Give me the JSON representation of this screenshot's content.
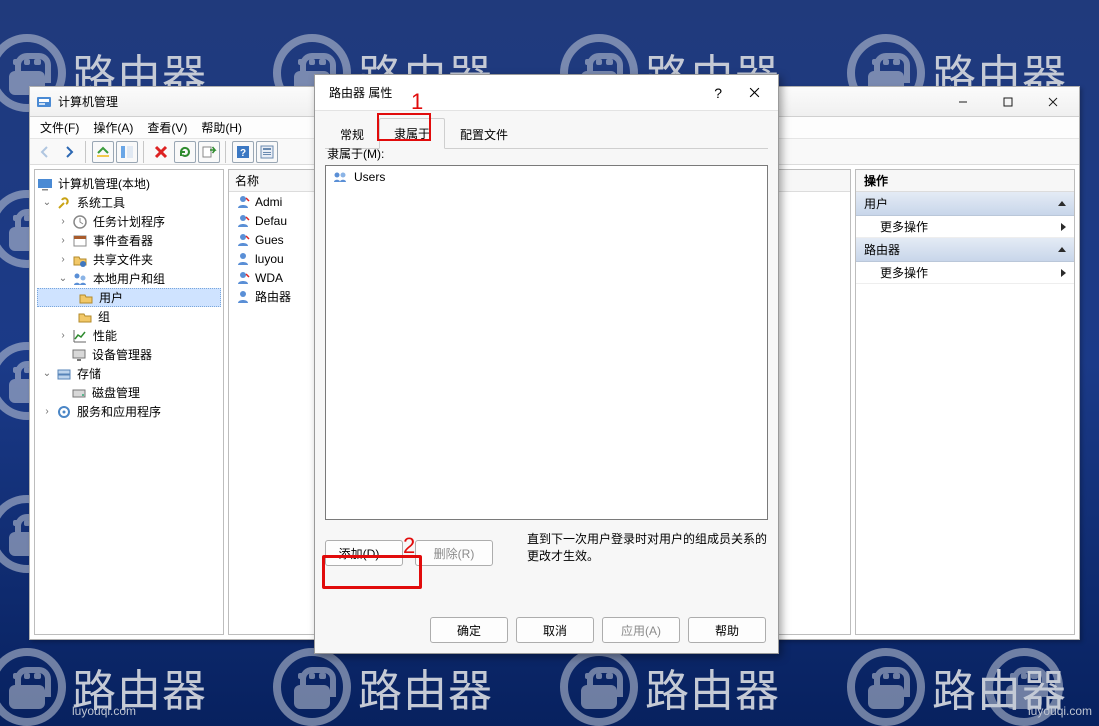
{
  "watermark": {
    "label": "路由器",
    "sub": "luyouqi.com"
  },
  "main_window": {
    "title": "计算机管理",
    "menu": [
      "文件(F)",
      "操作(A)",
      "查看(V)",
      "帮助(H)"
    ],
    "tree": {
      "root": "计算机管理(本地)",
      "system_tools": "系统工具",
      "task_scheduler": "任务计划程序",
      "event_viewer": "事件查看器",
      "shared_folders": "共享文件夹",
      "local_users": "本地用户和组",
      "users": "用户",
      "groups": "组",
      "performance": "性能",
      "device_manager": "设备管理器",
      "storage": "存储",
      "disk_management": "磁盘管理",
      "services": "服务和应用程序"
    },
    "list": {
      "header": "名称",
      "items": [
        "Admi",
        "Defau",
        "Gues",
        "luyou",
        "WDA",
        "路由器"
      ]
    },
    "actions": {
      "header": "操作",
      "sec1": "用户",
      "more": "更多操作",
      "sec2": "路由器"
    }
  },
  "dialog": {
    "title": "路由器 属性",
    "tabs": {
      "general": "常规",
      "member_of": "隶属于",
      "profile": "配置文件"
    },
    "member_label": "隶属于(M):",
    "members": [
      "Users"
    ],
    "note": "直到下一次用户登录时对用户的组成员关系的更改才生效。",
    "buttons": {
      "add": "添加(D)...",
      "remove": "删除(R)",
      "ok": "确定",
      "cancel": "取消",
      "apply": "应用(A)",
      "help": "帮助"
    }
  },
  "annotations": {
    "tab_num": "1",
    "add_num": "2"
  }
}
